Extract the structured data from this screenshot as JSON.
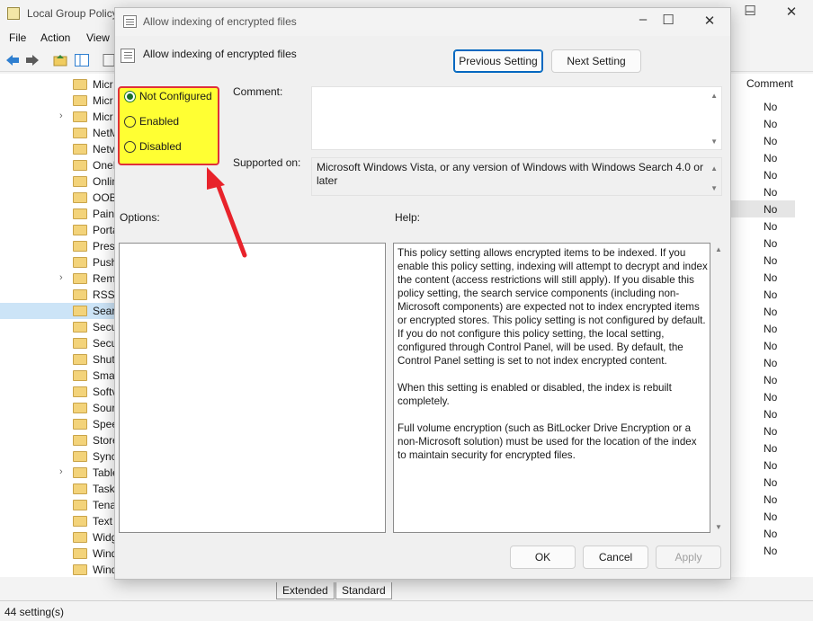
{
  "main": {
    "title": "Local Group Policy",
    "menu": [
      "File",
      "Action",
      "View"
    ],
    "tree_items": [
      "Micr",
      "Micr",
      "Micr",
      "NetM",
      "Netv",
      "OneI",
      "Onlin",
      "OOB",
      "Paint",
      "Porta",
      "Prese",
      "Push",
      "Rem",
      "RSS I",
      "Searc",
      "Secu",
      "Secu",
      "Shut",
      "Smar",
      "Softv",
      "Sour",
      "Spee",
      "Store",
      "Sync",
      "Table",
      "Task",
      "Tena",
      "Text",
      "Widg",
      "Wind",
      "Wind"
    ],
    "column_header": "Comment",
    "column_values": [
      "No",
      "No",
      "No",
      "No",
      "No",
      "No",
      "No",
      "No",
      "No",
      "No",
      "No",
      "No",
      "No",
      "No",
      "No",
      "No",
      "No",
      "No",
      "No",
      "No",
      "No",
      "No",
      "No",
      "No",
      "No",
      "No",
      "No"
    ],
    "tabs": [
      "Extended",
      "Standard"
    ],
    "status": "44 setting(s)"
  },
  "dialog": {
    "window_title": "Allow indexing of encrypted files",
    "header_title": "Allow indexing of encrypted files",
    "previous_label": "Previous Setting",
    "next_label": "Next Setting",
    "radios": {
      "not_configured": "Not Configured",
      "enabled": "Enabled",
      "disabled": "Disabled",
      "selected": "not_configured"
    },
    "comment_label": "Comment:",
    "supported_label": "Supported on:",
    "supported_value": "Microsoft Windows Vista, or any version of Windows with Windows Search 4.0 or later",
    "options_label": "Options:",
    "help_label": "Help:",
    "help_text": "This policy setting allows encrypted items to be indexed. If you enable this policy setting, indexing  will attempt to decrypt and index the content (access restrictions will still apply). If you disable this policy setting, the search service components (including non-Microsoft components) are expected not to index encrypted items or encrypted stores. This policy setting is not configured by default. If you do not configure this policy setting, the local setting, configured through Control Panel, will be used. By default, the Control Panel setting is set to not index encrypted content.\n\nWhen this setting is enabled or disabled, the index is rebuilt completely.\n\nFull volume encryption (such as BitLocker Drive Encryption or a non-Microsoft solution) must be used for the location of the index to maintain security for encrypted files.",
    "ok_label": "OK",
    "cancel_label": "Cancel",
    "apply_label": "Apply"
  },
  "colors": {
    "highlight": "#ffff33",
    "highlight_border": "#e0303a",
    "arrow": "#e8232b",
    "accent": "#0067c0"
  }
}
